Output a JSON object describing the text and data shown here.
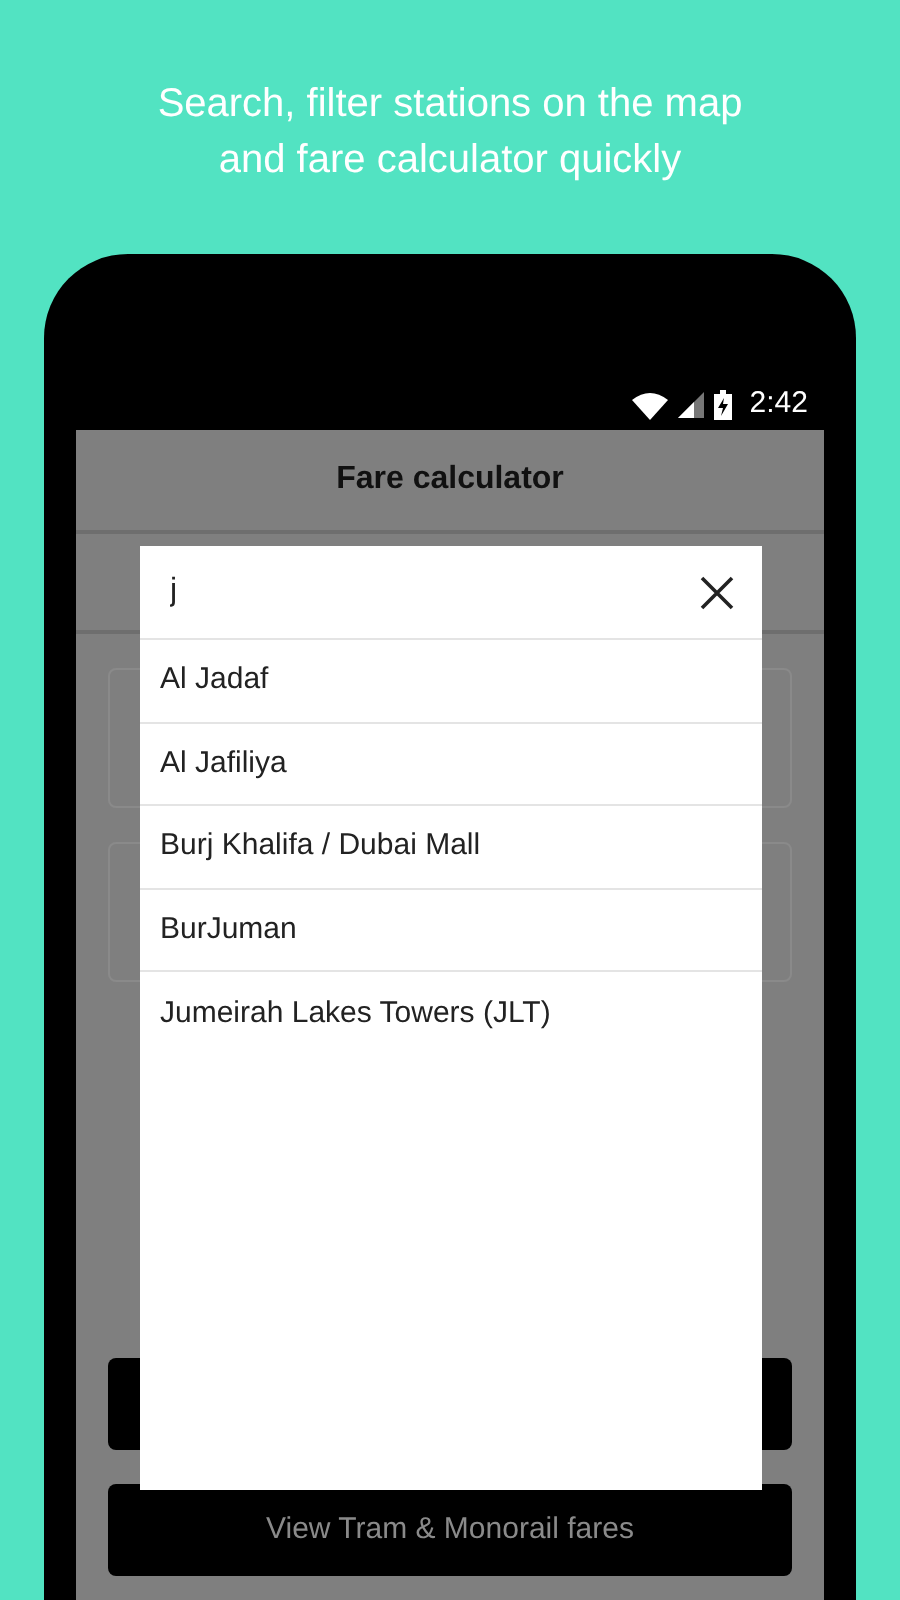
{
  "headline": [
    "Search, filter stations on the map",
    "and fare calculator quickly"
  ],
  "status_bar": {
    "time": "2:42"
  },
  "app_bar": {
    "title": "Fare calculator"
  },
  "fares_button": {
    "label": "View Tram & Monorail fares"
  },
  "dialog": {
    "search": {
      "value": "j"
    },
    "results": [
      "Al Jadaf",
      "Al Jafiliya",
      "Burj Khalifa / Dubai Mall",
      "BurJuman",
      "Jumeirah Lakes Towers (JLT)"
    ]
  }
}
